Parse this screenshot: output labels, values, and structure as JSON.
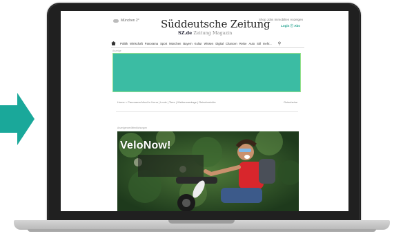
{
  "colors": {
    "accent": "#1aa89a",
    "banner": "#3bbca3",
    "banner_border": "#93e08a",
    "laptop_bezel": "#202020",
    "laptop_base": "#c4c4c4"
  },
  "header": {
    "weather": "München 2°",
    "logo": "Süddeutsche Zeitung",
    "sub": {
      "active": "SZ.de",
      "items": [
        "Zeitung",
        "Magazin"
      ]
    },
    "toplinks": "Shop   Jobs   Immobilien   Anzeigen",
    "login": "Login ⓘ   Abo"
  },
  "nav": {
    "items": [
      "Politik",
      "Wirtschaft",
      "Panorama",
      "Sport",
      "München",
      "Bayern",
      "Kultur",
      "Wissen",
      "Digital",
      "Chancen",
      "Reise",
      "Auto",
      "Stil",
      "mehr..."
    ],
    "icons": [
      "home-icon",
      "search-icon"
    ]
  },
  "ad": {
    "label": "Anzeige"
  },
  "breadcrumb": {
    "left": "Home > Panorama    Mord in Unna | Louis | Tiere | Wetterwarnlage | Reiseberichte",
    "right": "Gutscheine"
  },
  "article": {
    "label": "Anzeigenveröffentlichungen",
    "headline": "VeloNow!"
  }
}
